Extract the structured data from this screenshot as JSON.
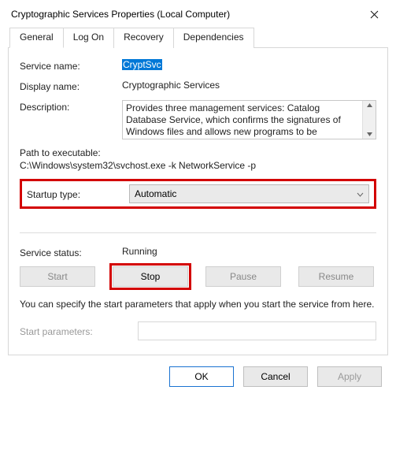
{
  "window": {
    "title": "Cryptographic Services Properties (Local Computer)"
  },
  "tabs": {
    "general": "General",
    "logon": "Log On",
    "recovery": "Recovery",
    "dependencies": "Dependencies"
  },
  "general": {
    "service_name_label": "Service name:",
    "service_name_value": "CryptSvc",
    "display_name_label": "Display name:",
    "display_name_value": "Cryptographic Services",
    "description_label": "Description:",
    "description_value": "Provides three management services: Catalog Database Service, which confirms the signatures of Windows files and allows new programs to be",
    "path_label": "Path to executable:",
    "path_value": "C:\\Windows\\system32\\svchost.exe -k NetworkService -p",
    "startup_label": "Startup type:",
    "startup_value": "Automatic",
    "status_label": "Service status:",
    "status_value": "Running",
    "buttons": {
      "start": "Start",
      "stop": "Stop",
      "pause": "Pause",
      "resume": "Resume"
    },
    "note": "You can specify the start parameters that apply when you start the service from here.",
    "start_params_label": "Start parameters:",
    "start_params_value": ""
  },
  "dialog_buttons": {
    "ok": "OK",
    "cancel": "Cancel",
    "apply": "Apply"
  }
}
